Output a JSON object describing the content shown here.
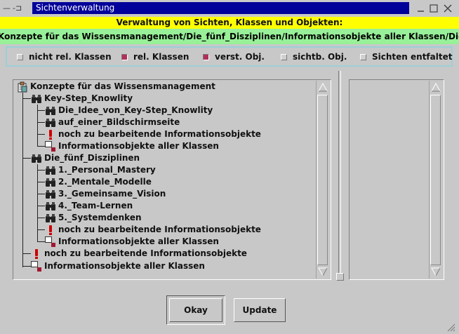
{
  "window": {
    "title": "Sichtenverwaltung",
    "colors": {
      "titlebar": "#00009a",
      "header": "#ffff00",
      "path": "#98f098",
      "check_on": "#b0305a"
    }
  },
  "header": {
    "title": "Verwaltung von Sichten, Klassen und Objekten:",
    "path": "Konzepte für das Wissensmanagement/Die_fünf_Disziplinen/Informationsobjekte aller Klassen/Die_fünf_Disziplinen"
  },
  "options": [
    {
      "label": "nicht rel. Klassen",
      "checked": false
    },
    {
      "label": "rel. Klassen",
      "checked": true
    },
    {
      "label": "verst. Obj.",
      "checked": true
    },
    {
      "label": "sichtb. Obj.",
      "checked": false
    },
    {
      "label": "Sichten entfaltet",
      "checked": false
    }
  ],
  "tree": {
    "root": {
      "label": "Konzepte für das Wissensmanagement",
      "icon": "clipboard-icon"
    },
    "nodes": [
      {
        "label": "Key-Step_Knowlity",
        "icon": "binoculars-icon"
      },
      {
        "label": "Die_Idee_von_Key-Step_Knowlity",
        "icon": "binoculars-icon"
      },
      {
        "label": "auf_einer_Bildschirmseite",
        "icon": "binoculars-icon"
      },
      {
        "label": "noch zu bearbeitende Informationsobjekte",
        "icon": "exclamation-icon"
      },
      {
        "label": "Informationsobjekte aller Klassen",
        "icon": "objects-icon"
      },
      {
        "label": "Die_fünf_Disziplinen",
        "icon": "binoculars-icon"
      },
      {
        "label": "1._Personal_Mastery",
        "icon": "binoculars-icon"
      },
      {
        "label": "2._Mentale_Modelle",
        "icon": "binoculars-icon"
      },
      {
        "label": "3._Gemeinsame_Vision",
        "icon": "binoculars-icon"
      },
      {
        "label": "4._Team-Lernen",
        "icon": "binoculars-icon"
      },
      {
        "label": "5._Systemdenken",
        "icon": "binoculars-icon"
      },
      {
        "label": "noch zu bearbeitende Informationsobjekte",
        "icon": "exclamation-icon"
      },
      {
        "label": "Informationsobjekte aller Klassen",
        "icon": "objects-icon"
      },
      {
        "label": "noch zu bearbeitende Informationsobjekte",
        "icon": "exclamation-icon"
      },
      {
        "label": "Informationsobjekte aller Klassen",
        "icon": "objects-icon"
      }
    ]
  },
  "buttons": {
    "ok": "Okay",
    "update": "Update"
  }
}
